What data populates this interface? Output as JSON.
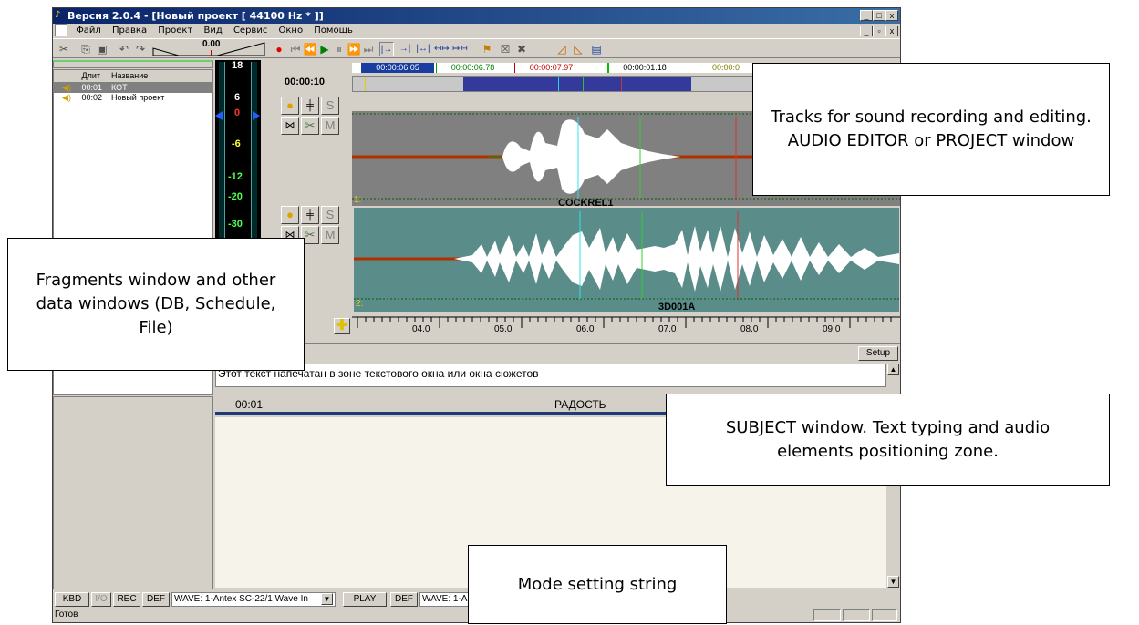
{
  "window": {
    "title": "Версия 2.0.4 - [Новый проект [ 44100 Hz * ]]",
    "controls": [
      "_",
      "□",
      "x"
    ],
    "mdi_controls": [
      "_",
      "▫",
      "x"
    ]
  },
  "menu": [
    "Файл",
    "Правка",
    "Проект",
    "Вид",
    "Сервис",
    "Окно",
    "Помощь"
  ],
  "toolbar": {
    "level_value": "0.00"
  },
  "fragments": {
    "headers": [
      "Длит",
      "Название"
    ],
    "rows": [
      {
        "duration": "00:01",
        "name": "КОТ"
      },
      {
        "duration": "00:02",
        "name": "Новый проект"
      }
    ]
  },
  "meter": {
    "scale": [
      "18",
      "6",
      "0",
      "-6",
      "-12",
      "-20",
      "-30"
    ]
  },
  "timeline": {
    "position": "00:00:10",
    "markers": [
      "00:00:06.05",
      "00:00:06.78",
      "00:00:07.97",
      "00:00:01.18",
      "00:00:0"
    ]
  },
  "tracks": [
    {
      "index": "1:",
      "name": "COCKREL1",
      "solo": "S",
      "mute": "M"
    },
    {
      "index": "2:",
      "name": "3D001A",
      "solo": "S",
      "mute": "M"
    }
  ],
  "ruler": [
    "04.0",
    "05.0",
    "06.0",
    "07.0",
    "08.0",
    "09.0"
  ],
  "setup_label": "Setup",
  "text_zone": "Этот текст напечатан в зоне текстового окна или окна сюжетов",
  "subject": {
    "time": "00:01",
    "title": "РАДОСТЬ"
  },
  "mode_bar": {
    "kbd": "KBD",
    "io": "I/O",
    "rec": "REC",
    "def1": "DEF",
    "wave_in": "WAVE: 1-Antex SC-22/1 Wave In",
    "play": "PLAY",
    "def2": "DEF",
    "wave_out": "WAVE: 1-A"
  },
  "status": "Готов",
  "callouts": {
    "tracks": "Tracks for sound recording and editing. AUDIO EDITOR or PROJECT window",
    "fragments": "Fragments window and other data windows (DB, Schedule, File)",
    "subject": "SUBJECT window. Text typing and audio elements positioning zone.",
    "mode": "Mode setting string"
  },
  "colors": {
    "titlebar": "#0a246a",
    "track1_bg": "#808080",
    "track2_bg": "#5a8c8a",
    "meter_bg": "#000000",
    "marker_blue": "#1a3ea0"
  }
}
